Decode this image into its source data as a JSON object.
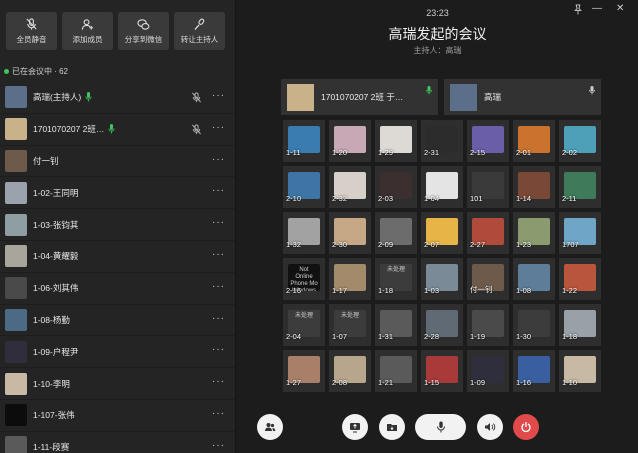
{
  "toolbar": [
    {
      "label": "全员静音",
      "icon": "mic-off-icon"
    },
    {
      "label": "添加成员",
      "icon": "add-user-icon"
    },
    {
      "label": "分享到微信",
      "icon": "wechat-icon"
    },
    {
      "label": "转让主持人",
      "icon": "mic-transfer-icon"
    }
  ],
  "status": {
    "text": "已在会议中 · 62"
  },
  "participants": [
    {
      "name": "高瑞(主持人)",
      "mic": true,
      "muted": true,
      "color": "#5b6e8a"
    },
    {
      "name": "1701070207 2班…",
      "mic": true,
      "muted": true,
      "color": "#c9b28a"
    },
    {
      "name": "付一钊",
      "mic": false,
      "muted": false,
      "color": "#6d5a4a"
    },
    {
      "name": "1-02-王同明",
      "mic": false,
      "muted": false,
      "color": "#9aa3ad"
    },
    {
      "name": "1-03-张钧其",
      "mic": false,
      "muted": false,
      "color": "#8e9ea3"
    },
    {
      "name": "1-04-黄耀毅",
      "mic": false,
      "muted": false,
      "color": "#a7a59c"
    },
    {
      "name": "1-06-刘其伟",
      "mic": false,
      "muted": false,
      "color": "#4a4a4a"
    },
    {
      "name": "1-08-杨勤",
      "mic": false,
      "muted": false,
      "color": "#4c6a86"
    },
    {
      "name": "1-09-户程尹",
      "mic": false,
      "muted": false,
      "color": "#2e2e3c"
    },
    {
      "name": "1-10-李明",
      "mic": false,
      "muted": false,
      "color": "#c7b9a4"
    },
    {
      "name": "1-107-张伟",
      "mic": false,
      "muted": false,
      "color": "#0c0c0c"
    },
    {
      "name": "1-11-段赛",
      "mic": false,
      "muted": false,
      "color": "#5a5a5a"
    }
  ],
  "header": {
    "time": "23:23",
    "title": "高瑞发起的会议",
    "host": "主持人：高瑞"
  },
  "speakers": [
    {
      "name": "1701070207 2班 于…",
      "mic_color": "#3ec55d",
      "color": "#c9b28a"
    },
    {
      "name": "高瑞",
      "mic_color": "#cfcfcf",
      "color": "#5b6e8a"
    }
  ],
  "grid": [
    {
      "label": "1-11",
      "color": "#3a7bb0"
    },
    {
      "label": "1-20",
      "color": "#c9a8b6"
    },
    {
      "label": "1-29",
      "color": "#ddd9d4"
    },
    {
      "label": "2-31",
      "color": "#2c2c2c"
    },
    {
      "label": "2-15",
      "color": "#6b5ea8"
    },
    {
      "label": "2-01",
      "color": "#c9732e"
    },
    {
      "label": "2-02",
      "color": "#4ea0b8"
    },
    {
      "label": "2-10",
      "color": "#3f75a6"
    },
    {
      "label": "2-32",
      "color": "#d7d0c9"
    },
    {
      "label": "2-03",
      "color": "#3b2f2f"
    },
    {
      "label": "1-04",
      "color": "#e4e4e4"
    },
    {
      "label": "101",
      "color": "#3a3a3a"
    },
    {
      "label": "1-14",
      "color": "#7a4836"
    },
    {
      "label": "2-11",
      "color": "#3f7a5a"
    },
    {
      "label": "1-32",
      "color": "#a2a2a2"
    },
    {
      "label": "2-30",
      "color": "#c6a786"
    },
    {
      "label": "2-09",
      "color": "#6c6c6c"
    },
    {
      "label": "2-07",
      "color": "#e7b447"
    },
    {
      "label": "2-27",
      "color": "#b04a3a"
    },
    {
      "label": "1-23",
      "color": "#8a9b70"
    },
    {
      "label": "1707",
      "color": "#6fa6c8"
    },
    {
      "label": "2-16",
      "color": "#111111",
      "text": "Not Online Phone Mo Windows"
    },
    {
      "label": "1-17",
      "color": "#a28a6a"
    },
    {
      "label": "1-18",
      "color": "#3c3c3c",
      "text": "未处理"
    },
    {
      "label": "1-03",
      "color": "#7a8a96"
    },
    {
      "label": "付一钊",
      "color": "#6d5a4a"
    },
    {
      "label": "1-08",
      "color": "#5d7d98"
    },
    {
      "label": "1-22",
      "color": "#b8553c"
    },
    {
      "label": "2-04",
      "color": "#3c3c3c",
      "text": "未处理"
    },
    {
      "label": "1-07",
      "color": "#3c3c3c",
      "text": "未处理"
    },
    {
      "label": "1-31",
      "color": "#5a5a5a"
    },
    {
      "label": "2-28",
      "color": "#5f6a74"
    },
    {
      "label": "1-19",
      "color": "#4a4a4a"
    },
    {
      "label": "1-30",
      "color": "#3c3c3c"
    },
    {
      "label": "1-18",
      "color": "#9aa0a8"
    },
    {
      "label": "1-27",
      "color": "#a8806a"
    },
    {
      "label": "2-08",
      "color": "#b7a68c"
    },
    {
      "label": "1-21",
      "color": "#5a5a5a"
    },
    {
      "label": "1-15",
      "color": "#a83a3a"
    },
    {
      "label": "1-09",
      "color": "#2e2e3c"
    },
    {
      "label": "1-16",
      "color": "#3a5fa0"
    },
    {
      "label": "1-10",
      "color": "#c7b9a4"
    }
  ],
  "controls": [
    {
      "name": "members-button",
      "icon": "members-icon"
    },
    {
      "name": "share-screen-button",
      "icon": "screen-share-icon"
    },
    {
      "name": "file-button",
      "icon": "folder-icon"
    },
    {
      "name": "mic-button",
      "icon": "mic-icon"
    },
    {
      "name": "speaker-button",
      "icon": "speaker-icon"
    },
    {
      "name": "hangup-button",
      "icon": "power-icon"
    }
  ]
}
